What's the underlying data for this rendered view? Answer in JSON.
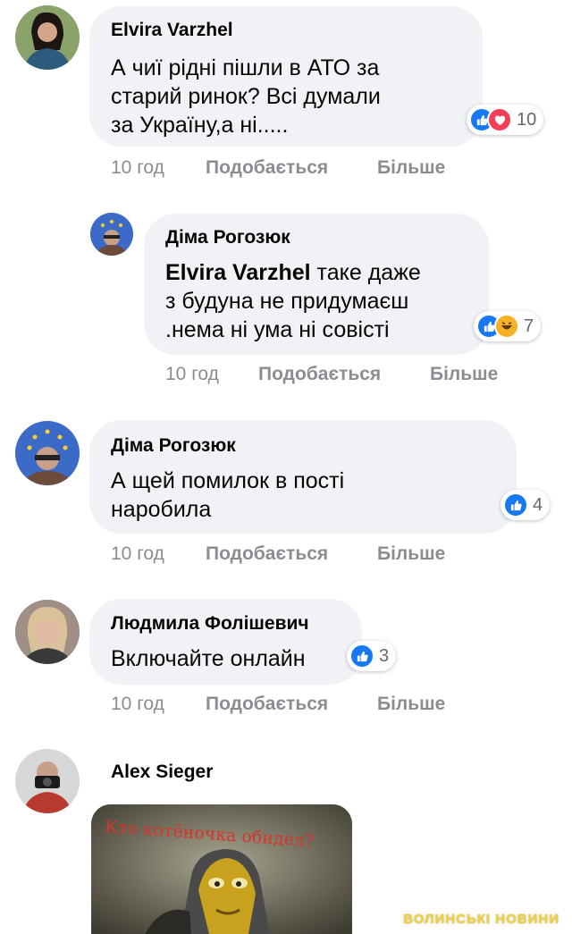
{
  "comments": [
    {
      "author": "Elvira Varzhel",
      "text_lines": [
        "А чиї рідні пішли в АТО за",
        "старий ринок? Всі думали",
        "за Україну,а ні....."
      ],
      "reaction_count": "10",
      "time": "10 год",
      "like": "Подобається",
      "more": "Більше"
    },
    {
      "author": "Діма Рогозюк",
      "mention": "Elvira Varzhel",
      "text_lines": [
        " таке даже",
        "з будуна не придумаєш",
        ".нема ні ума ні совісті"
      ],
      "reaction_count": "7",
      "time": "10 год",
      "like": "Подобається",
      "more": "Більше"
    },
    {
      "author": "Діма Рогозюк",
      "text_lines": [
        "А щей помилок в пості",
        "наробила"
      ],
      "reaction_count": "4",
      "time": "10 год",
      "like": "Подобається",
      "more": "Більше"
    },
    {
      "author": "Людмила Фолішевич",
      "text_lines": [
        "Включайте онлайн"
      ],
      "reaction_count": "3",
      "time": "10 год",
      "like": "Подобається",
      "more": "Більше"
    },
    {
      "author": "Alex Sieger"
    }
  ],
  "meme_caption": "Кто котёночка обидел?",
  "watermark": "ВОЛИНСЬКІ НОВИНИ",
  "icons": {
    "like": "like-reaction-icon",
    "love": "love-reaction-icon",
    "haha": "haha-reaction-icon"
  },
  "colors": {
    "like": "#1877f2",
    "love": "#f33e58",
    "haha": "#f7b125",
    "bubble": "#f0f2f5",
    "meta": "#8a8d91",
    "watermark": "#f2d22a"
  }
}
